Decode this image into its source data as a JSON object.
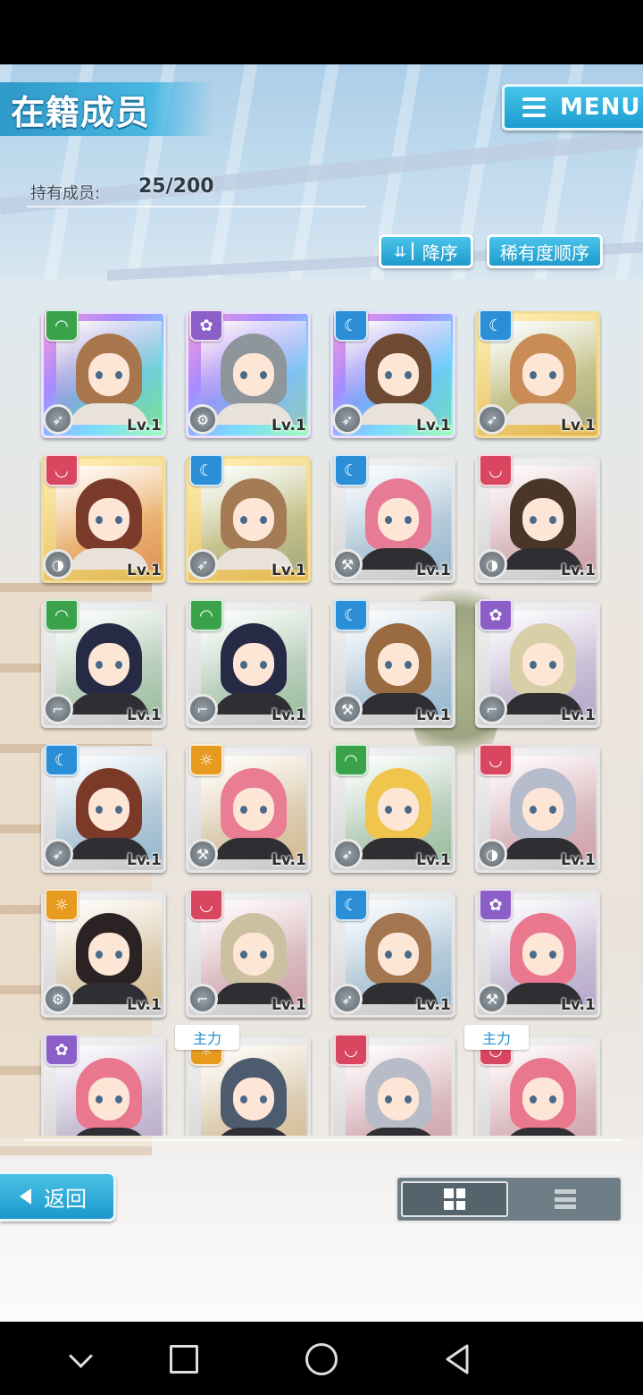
{
  "screen": {
    "title": "在籍成员",
    "menu_label": "MENU",
    "member_label": "持有成员:",
    "member_count": "25/200",
    "sort_order_label": "降序",
    "sort_rarity_label": "稀有度顺序",
    "back_label": "返回",
    "view_modes": [
      "grid-view-icon",
      "list-view-icon"
    ],
    "active_view": "grid"
  },
  "colors": {
    "accent": "#23a3d6",
    "attr_green": "#3aa34a",
    "attr_purple": "#8b5fc7",
    "attr_blue": "#2a8fd6",
    "attr_red": "#d9465f",
    "attr_orange": "#e69a1e"
  },
  "cards": [
    {
      "level": "Lv.1",
      "attribute": "green",
      "attr_icon": "wave-icon",
      "weapon_icon": "blade-icon",
      "frame": "rainbow",
      "hair": "#a8764c",
      "tag": ""
    },
    {
      "level": "Lv.1",
      "attribute": "purple",
      "attr_icon": "flower-icon",
      "weapon_icon": "gear-icon",
      "frame": "rainbow",
      "hair": "#8e959b",
      "tag": ""
    },
    {
      "level": "Lv.1",
      "attribute": "blue",
      "attr_icon": "moon-icon",
      "weapon_icon": "blade-icon",
      "frame": "rainbow",
      "hair": "#6e4a32",
      "tag": ""
    },
    {
      "level": "Lv.1",
      "attribute": "blue",
      "attr_icon": "moon-icon",
      "weapon_icon": "blade-icon",
      "frame": "gold",
      "hair": "#c98c56",
      "tag": ""
    },
    {
      "level": "Lv.1",
      "attribute": "red",
      "attr_icon": "crescent-icon",
      "weapon_icon": "shield-icon",
      "frame": "gold",
      "hair": "#7a3b2a",
      "tag": ""
    },
    {
      "level": "Lv.1",
      "attribute": "blue",
      "attr_icon": "moon-icon",
      "weapon_icon": "blade-icon",
      "frame": "gold",
      "hair": "#a57b55",
      "tag": ""
    },
    {
      "level": "Lv.1",
      "attribute": "blue",
      "attr_icon": "moon-icon",
      "weapon_icon": "hammer-icon",
      "frame": "silver",
      "hair": "#e77a94",
      "tag": ""
    },
    {
      "level": "Lv.1",
      "attribute": "red",
      "attr_icon": "crescent-icon",
      "weapon_icon": "shield-icon",
      "frame": "silver",
      "hair": "#4a3628",
      "tag": ""
    },
    {
      "level": "Lv.1",
      "attribute": "green",
      "attr_icon": "wave-icon",
      "weapon_icon": "gun-icon",
      "frame": "silver",
      "hair": "#262a45",
      "tag": ""
    },
    {
      "level": "Lv.1",
      "attribute": "green",
      "attr_icon": "wave-icon",
      "weapon_icon": "gun-icon",
      "frame": "silver",
      "hair": "#262a45",
      "tag": ""
    },
    {
      "level": "Lv.1",
      "attribute": "blue",
      "attr_icon": "moon-icon",
      "weapon_icon": "hammer-icon",
      "frame": "silver",
      "hair": "#9a6a40",
      "tag": ""
    },
    {
      "level": "Lv.1",
      "attribute": "purple",
      "attr_icon": "flower-icon",
      "weapon_icon": "gun-icon",
      "frame": "silver",
      "hair": "#d8cfa8",
      "tag": ""
    },
    {
      "level": "Lv.1",
      "attribute": "blue",
      "attr_icon": "moon-icon",
      "weapon_icon": "blade-icon",
      "frame": "silver",
      "hair": "#7b3a28",
      "tag": ""
    },
    {
      "level": "Lv.1",
      "attribute": "orange",
      "attr_icon": "sun-icon",
      "weapon_icon": "hammer-icon",
      "frame": "silver",
      "hair": "#ea7d93",
      "tag": ""
    },
    {
      "level": "Lv.1",
      "attribute": "green",
      "attr_icon": "wave-icon",
      "weapon_icon": "blade-icon",
      "frame": "silver",
      "hair": "#f0c54e",
      "tag": ""
    },
    {
      "level": "Lv.1",
      "attribute": "red",
      "attr_icon": "crescent-icon",
      "weapon_icon": "shield-icon",
      "frame": "silver",
      "hair": "#b6bccb",
      "tag": ""
    },
    {
      "level": "Lv.1",
      "attribute": "orange",
      "attr_icon": "sun-icon",
      "weapon_icon": "gear-icon",
      "frame": "silver",
      "hair": "#2b2223",
      "tag": ""
    },
    {
      "level": "Lv.1",
      "attribute": "red",
      "attr_icon": "crescent-icon",
      "weapon_icon": "gun-icon",
      "frame": "silver",
      "hair": "#cbc1a0",
      "tag": ""
    },
    {
      "level": "Lv.1",
      "attribute": "blue",
      "attr_icon": "moon-icon",
      "weapon_icon": "blade-icon",
      "frame": "silver",
      "hair": "#a47650",
      "tag": ""
    },
    {
      "level": "Lv.1",
      "attribute": "purple",
      "attr_icon": "flower-icon",
      "weapon_icon": "hammer-icon",
      "frame": "silver",
      "hair": "#e9788e",
      "tag": ""
    },
    {
      "level": "",
      "attribute": "purple",
      "attr_icon": "flower-icon",
      "weapon_icon": "",
      "frame": "silver",
      "hair": "#e9788e",
      "tag": ""
    },
    {
      "level": "",
      "attribute": "orange",
      "attr_icon": "sun-icon",
      "weapon_icon": "",
      "frame": "silver",
      "hair": "#4d5b6f",
      "tag": "主力"
    },
    {
      "level": "",
      "attribute": "red",
      "attr_icon": "crescent-icon",
      "weapon_icon": "",
      "frame": "silver",
      "hair": "#b7bcc8",
      "tag": ""
    },
    {
      "level": "",
      "attribute": "red",
      "attr_icon": "crescent-icon",
      "weapon_icon": "",
      "frame": "silver",
      "hair": "#e9788e",
      "tag": "主力"
    }
  ]
}
